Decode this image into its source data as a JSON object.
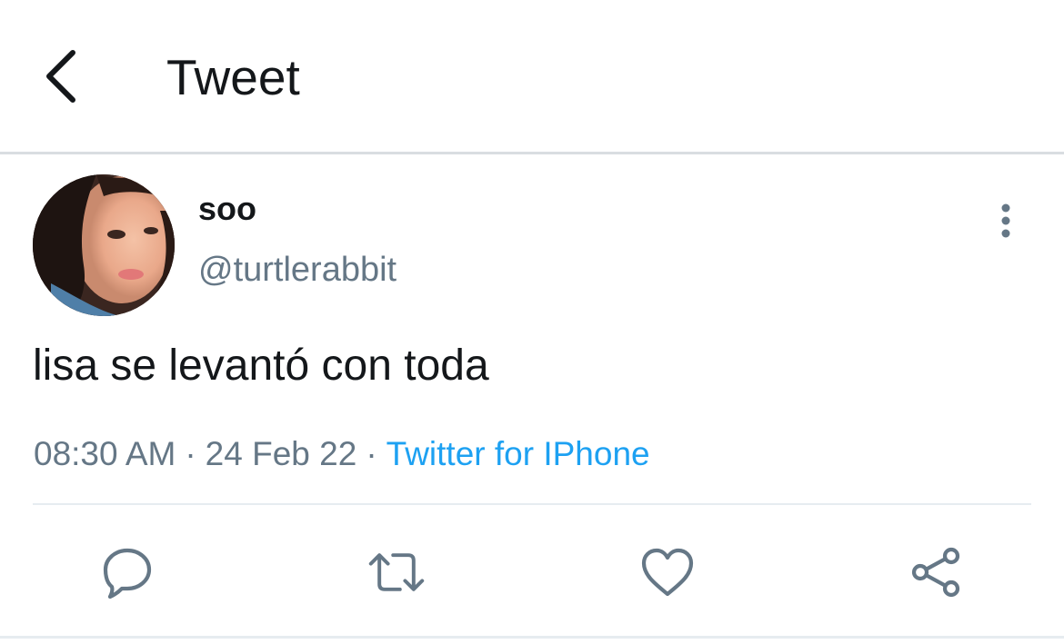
{
  "header": {
    "title": "Tweet",
    "back_icon": "chevron-left-icon"
  },
  "tweet": {
    "author": {
      "display_name": "soo",
      "handle": "@turtlerabbit",
      "avatar": "avatar-photo"
    },
    "text": "lisa se levantó con toda",
    "time": "08:30 AM",
    "separator": "·",
    "date": "24 Feb 22",
    "source": "Twitter for IPhone",
    "more_icon": "more-vertical-icon"
  },
  "actions": [
    {
      "name": "reply",
      "icon": "reply-icon"
    },
    {
      "name": "retweet",
      "icon": "retweet-icon"
    },
    {
      "name": "like",
      "icon": "heart-icon"
    },
    {
      "name": "share",
      "icon": "share-icon"
    }
  ],
  "colors": {
    "text_primary": "#14171a",
    "text_secondary": "#657786",
    "link": "#1da1f2",
    "divider": "#e6ecf0",
    "icon": "#657786"
  }
}
